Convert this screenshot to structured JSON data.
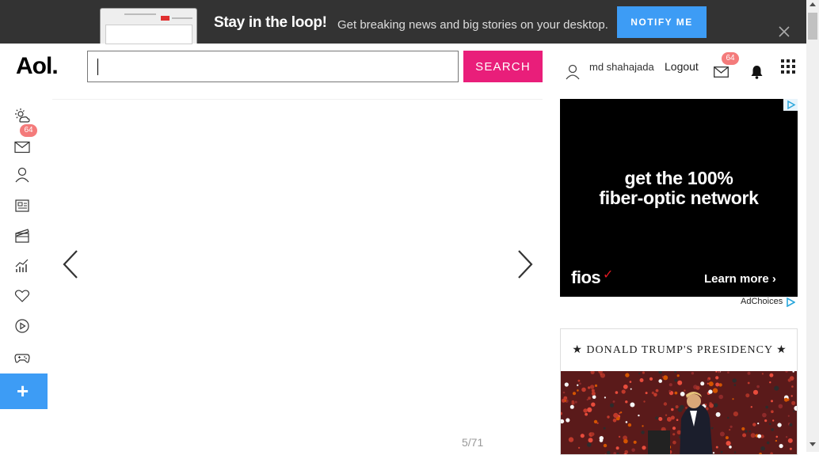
{
  "banner": {
    "headline": "Stay in the loop!",
    "subtext": "Get breaking news and big stories on your desktop.",
    "notify_label": "NOTIFY ME"
  },
  "header": {
    "logo": "Aol.",
    "search": {
      "value": "",
      "placeholder": ""
    },
    "search_button": "SEARCH",
    "username": "md shahajada",
    "logout": "Logout",
    "mail_count": "64"
  },
  "rail": {
    "items": [
      {
        "icon": "weather-icon"
      },
      {
        "icon": "mail-icon",
        "badge": "64"
      },
      {
        "icon": "profile-icon"
      },
      {
        "icon": "news-icon"
      },
      {
        "icon": "entertainment-icon"
      },
      {
        "icon": "finance-icon"
      },
      {
        "icon": "lifestyle-icon"
      },
      {
        "icon": "video-icon"
      },
      {
        "icon": "games-icon"
      },
      {
        "icon": "plus-icon"
      }
    ]
  },
  "slideshow": {
    "counter": "5/71"
  },
  "ad": {
    "headline_line1": "get the 100%",
    "headline_line2": "fiber-optic network",
    "brand": "fios",
    "cta": "Learn more",
    "adchoices": "AdChoices"
  },
  "card": {
    "title": "★ DONALD TRUMP'S PRESIDENCY ★"
  },
  "colors": {
    "accent_pink": "#e91e7a",
    "accent_blue": "#3d9cf5",
    "badge": "#f47b7b",
    "banner_bg": "#333333"
  }
}
